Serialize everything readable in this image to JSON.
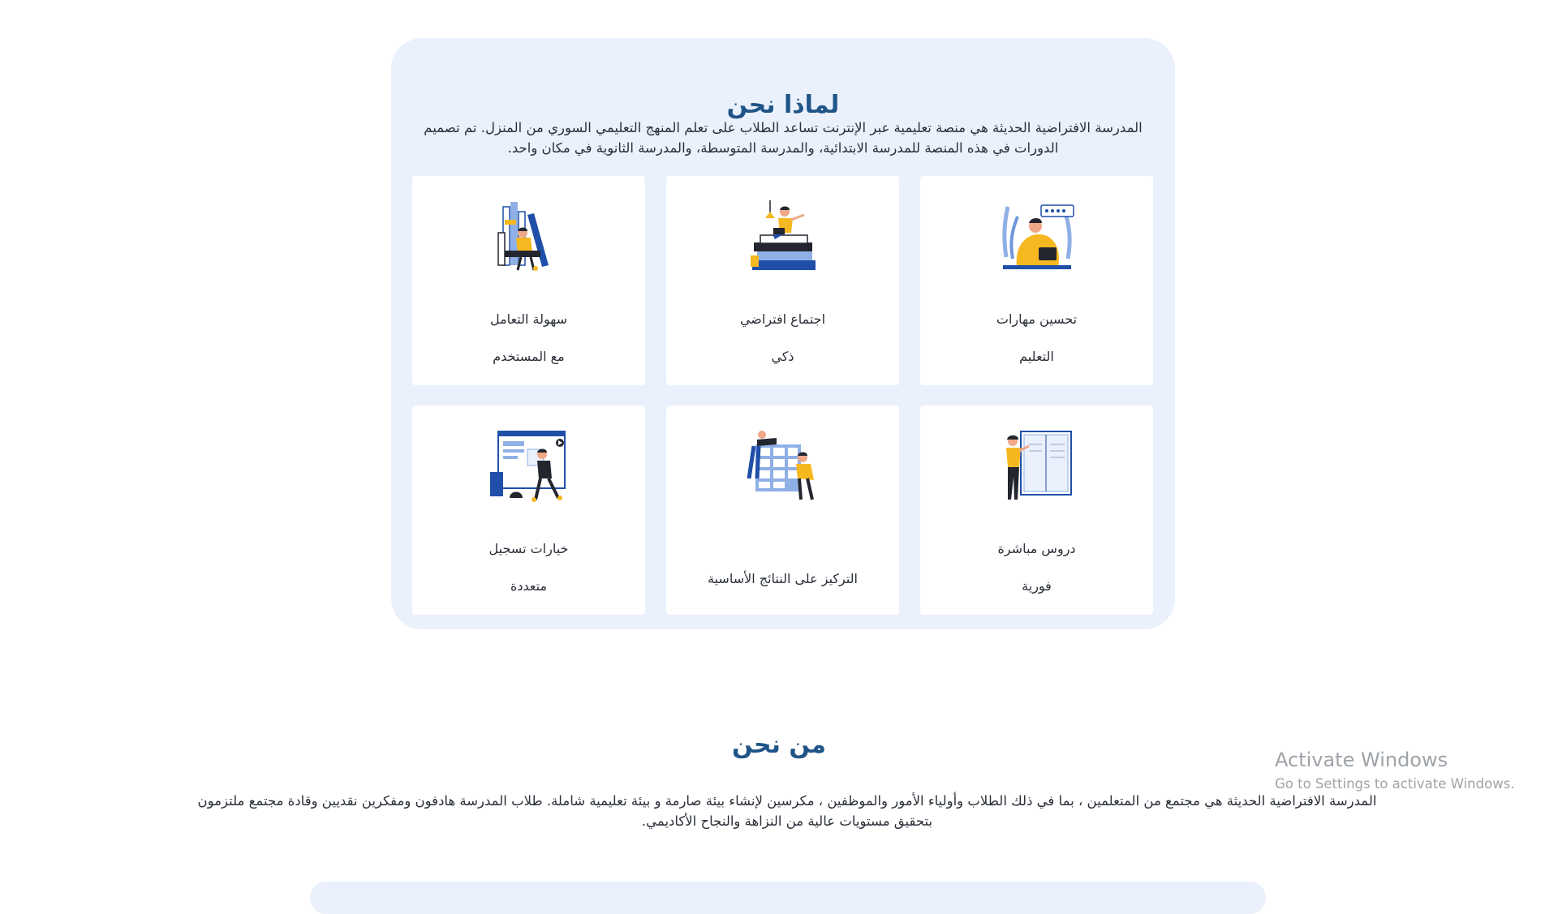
{
  "why_section": {
    "title": "لماذا نحن",
    "description": "المدرسة الافتراضية الحديثة هي منصة تعليمية عبر الإنترنت تساعد الطلاب على تعلم المنهج التعليمي السوري من المنزل. تم تصميم الدورات في هذه المنصة للمدرسة الابتدائية، والمدرسة المتوسطة، والمدرسة الثانوية في مكان واحد.",
    "features": [
      {
        "line1": "تحسين مهارات",
        "line2": "التعليم",
        "illustration": "student-laptop-rating-illustration"
      },
      {
        "line1": "اجتماع افتراضي",
        "line2": "ذكي",
        "illustration": "student-on-books-illustration"
      },
      {
        "line1": "سهولة التعامل",
        "line2": "مع المستخدم",
        "illustration": "student-bookshelf-illustration"
      },
      {
        "line1": "دروس مباشرة",
        "line2": "فورية",
        "illustration": "student-open-book-illustration"
      },
      {
        "line1": "التركيز على النتائج الأساسية",
        "line2": "",
        "illustration": "team-building-blocks-illustration"
      },
      {
        "line1": "خيارات تسجيل",
        "line2": "متعددة",
        "illustration": "student-video-board-illustration"
      }
    ]
  },
  "who_section": {
    "title": "من نحن",
    "description": "المدرسة الافتراضية الحديثة هي مجتمع من المتعلمين ، بما في ذلك الطلاب وأولياء الأمور والموظفين ، مكرسين لإنشاء بيئة صارمة و بيئة تعليمية شاملة. طلاب المدرسة هادفون ومفكرين نقديين وقادة مجتمع ملتزمون بتحقيق مستويات عالية من النزاهة والنجاح الأكاديمي."
  },
  "watermark": {
    "title": "Activate Windows",
    "subtitle": "Go to Settings to activate Windows."
  },
  "colors": {
    "panel_bg": "#eaf1fd",
    "heading": "#1f5487",
    "accent_yellow": "#f5b820",
    "accent_blue": "#1f4fa8",
    "dark": "#23262e"
  }
}
